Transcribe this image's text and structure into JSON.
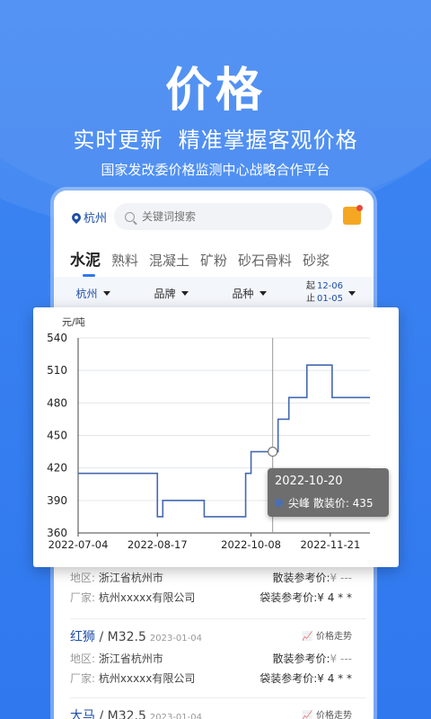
{
  "hero": {
    "title": "价格",
    "subtitle": "实时更新  精准掌握客观价格",
    "tagline": "国家发改委价格监测中心战略合作平台"
  },
  "topbar": {
    "city": "杭州",
    "search_placeholder": "关键词搜索"
  },
  "tabs": [
    "水泥",
    "熟料",
    "混凝土",
    "矿粉",
    "砂石骨料",
    "砂浆"
  ],
  "filters": {
    "city": "杭州",
    "brand": "品牌",
    "variety": "品种",
    "start_label": "起",
    "start_date": "12-06",
    "end_label": "止",
    "end_date": "01-05"
  },
  "list": [
    {
      "brand": "",
      "spec": "",
      "date": "",
      "region_label": "地区:",
      "region": "浙江省杭州市",
      "maker_label": "厂家:",
      "maker": "杭州xxxxx有限公司",
      "bulk_label": "散装参考价:",
      "bulk_price": "¥ ---",
      "bag_label": "袋装参考价:",
      "bag_price": "¥ 4 * *"
    },
    {
      "brand": "红狮",
      "spec": " / M32.5",
      "date": "2023-01-04",
      "trend": "价格走势",
      "region_label": "地区:",
      "region": "浙江省杭州市",
      "maker_label": "厂家:",
      "maker": "杭州xxxxx有限公司",
      "bulk_label": "散装参考价:",
      "bulk_price": "¥ ---",
      "bag_label": "袋装参考价:",
      "bag_price": "¥ 4 * *"
    },
    {
      "brand": "大马",
      "spec": " / M32.5",
      "date": "2023-01-04",
      "trend": "价格走势"
    }
  ],
  "tooltip": {
    "date": "2022-10-20",
    "text": "尖峰 散装价: 435"
  },
  "chart_data": {
    "type": "line",
    "title": "",
    "ylabel": "元/吨",
    "xlabel": "",
    "ylim": [
      360,
      540
    ],
    "yticks": [
      360,
      390,
      420,
      450,
      480,
      510,
      540
    ],
    "xticks": [
      "2022-07-04",
      "2022-08-17",
      "2022-10-08",
      "2022-11-21"
    ],
    "grid": true,
    "series": [
      {
        "name": "尖峰",
        "x": [
          "2022-07-04",
          "2022-08-17",
          "2022-08-17",
          "2022-08-20",
          "2022-08-20",
          "2022-09-12",
          "2022-09-12",
          "2022-10-01",
          "2022-10-01",
          "2022-10-05",
          "2022-10-05",
          "2022-10-06",
          "2022-10-06",
          "2022-10-08",
          "2022-10-08",
          "2022-10-20",
          "2022-10-20",
          "2022-10-23",
          "2022-10-23",
          "2022-10-29",
          "2022-10-29",
          "2022-11-08",
          "2022-11-08",
          "2022-11-22",
          "2022-11-22",
          "2022-12-13"
        ],
        "values": [
          415,
          415,
          375,
          375,
          390,
          390,
          375,
          375,
          375,
          375,
          415,
          415,
          415,
          415,
          435,
          435,
          435,
          435,
          465,
          465,
          485,
          485,
          515,
          515,
          485,
          485
        ]
      }
    ],
    "highlight": {
      "x": "2022-10-20",
      "value": 435
    }
  }
}
